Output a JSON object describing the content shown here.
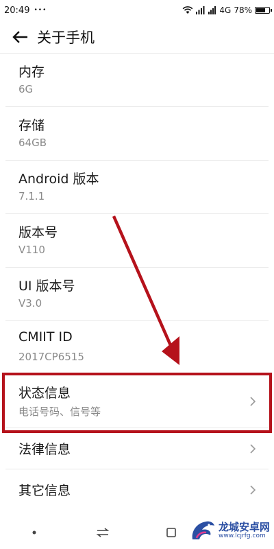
{
  "status_bar": {
    "time": "20:49",
    "dots": "•••",
    "network": "4G",
    "battery_percent": "78%",
    "battery_level": 0.78
  },
  "header": {
    "title": "关于手机"
  },
  "items": [
    {
      "title": "内存",
      "subtitle": "6G"
    },
    {
      "title": "存储",
      "subtitle": "64GB"
    },
    {
      "title": "Android 版本",
      "subtitle": "7.1.1"
    },
    {
      "title": "版本号",
      "subtitle": "V110"
    },
    {
      "title": "UI 版本号",
      "subtitle": "V3.0"
    },
    {
      "title": "CMIIT ID",
      "subtitle": "2017CP6515"
    },
    {
      "title": "状态信息",
      "subtitle": "电话号码、信号等"
    },
    {
      "title": "法律信息"
    },
    {
      "title": "其它信息"
    }
  ],
  "watermark": {
    "name": "龙城安卓网",
    "url": "www.lcjrfg.com"
  },
  "colors": {
    "annotation": "#b5121b",
    "divider": "#e8e8e8",
    "subtitle": "#8a8a8a"
  }
}
